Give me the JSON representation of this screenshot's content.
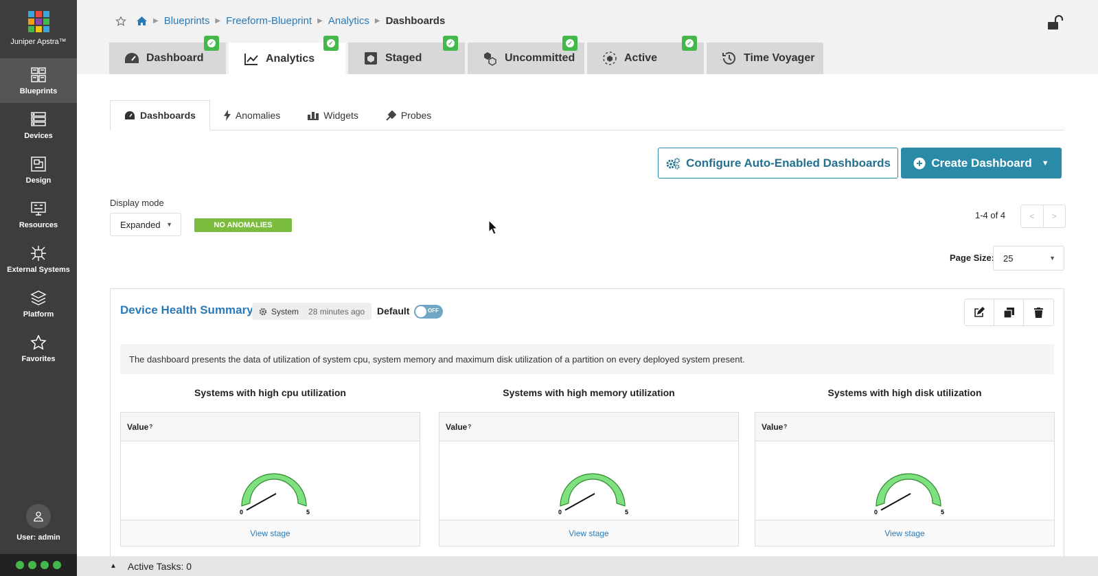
{
  "app": {
    "name": "Juniper Apstra™"
  },
  "sidebar": {
    "items": [
      {
        "label": "Blueprints",
        "icon": "blueprints-icon",
        "active": true
      },
      {
        "label": "Devices",
        "icon": "devices-icon"
      },
      {
        "label": "Design",
        "icon": "design-icon"
      },
      {
        "label": "Resources",
        "icon": "resources-icon"
      },
      {
        "label": "External Systems",
        "icon": "external-systems-icon"
      },
      {
        "label": "Platform",
        "icon": "platform-icon"
      },
      {
        "label": "Favorites",
        "icon": "star-icon"
      }
    ],
    "user_label": "User: admin"
  },
  "breadcrumb": [
    "Blueprints",
    "Freeform-Blueprint",
    "Analytics",
    "Dashboards"
  ],
  "main_tabs": [
    {
      "label": "Dashboard",
      "checked": true
    },
    {
      "label": "Analytics",
      "checked": true,
      "active": true
    },
    {
      "label": "Staged",
      "checked": true
    },
    {
      "label": "Uncommitted",
      "checked": true
    },
    {
      "label": "Active",
      "checked": true
    },
    {
      "label": "Time Voyager",
      "checked": false
    }
  ],
  "sub_tabs": [
    "Dashboards",
    "Anomalies",
    "Widgets",
    "Probes"
  ],
  "actions": {
    "configure_label": "Configure Auto-Enabled Dashboards",
    "create_label": "Create Dashboard"
  },
  "display_mode": {
    "label": "Display mode",
    "value": "Expanded"
  },
  "anomaly_badge": "NO ANOMALIES",
  "pagination": {
    "range": "1-4 of 4",
    "page_size_label": "Page Size:",
    "page_size": "25"
  },
  "dashboard": {
    "title": "Device Health Summary",
    "owner": "System",
    "updated": "28 minutes ago",
    "default_label": "Default",
    "default_toggle": "OFF",
    "description": "The dashboard presents the data of utilization of system cpu, system memory and maximum disk utilization of a partition on every deployed system present.",
    "widgets": [
      {
        "title": "Systems with high cpu utilization",
        "head": "Value",
        "min": "0",
        "max": "5",
        "value": 0,
        "link": "View stage"
      },
      {
        "title": "Systems with high memory utilization",
        "head": "Value",
        "min": "0",
        "max": "5",
        "value": 0,
        "link": "View stage"
      },
      {
        "title": "Systems with high disk utilization",
        "head": "Value",
        "min": "0",
        "max": "5",
        "value": 0,
        "link": "View stage"
      }
    ]
  },
  "footer": {
    "active_tasks": "Active Tasks: 0"
  },
  "colors": {
    "accent": "#2a8aa8",
    "success": "#44b84a",
    "sidebar": "#3d3d3d",
    "gauge": "#7ee07e"
  }
}
